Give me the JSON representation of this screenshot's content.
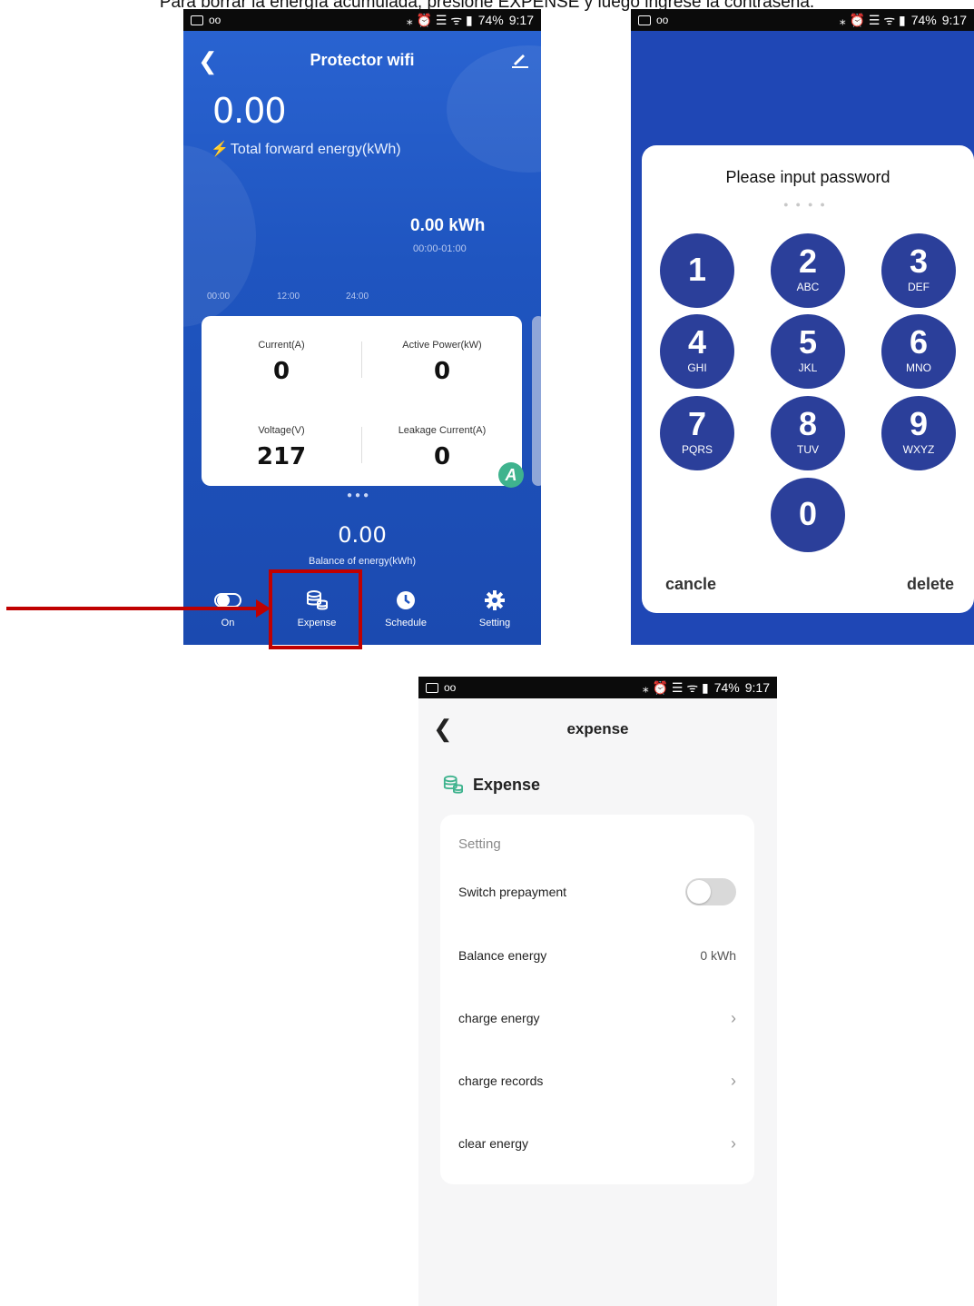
{
  "caption": "Para borrar la energía acumulada, presione EXPENSE y luego ingrese la contraseña.",
  "status": {
    "battery": "74%",
    "time": "9:17"
  },
  "colors": {
    "arrow": "#c00000",
    "app_blue": "#1f55c0",
    "key_blue": "#2b3f9a",
    "green_icon": "#3fb38e"
  },
  "home": {
    "title": "Protector wifi",
    "total_value": "0.00",
    "total_label": "Total forward energy(kWh)",
    "kwh_value": "0.00 kWh",
    "kwh_range": "00:00-01:00",
    "time_axis": [
      "00:00",
      "12:00",
      "24:00"
    ],
    "metrics": [
      {
        "label": "Current(A)",
        "value": "0"
      },
      {
        "label": "Active Power(kW)",
        "value": "0"
      },
      {
        "label": "Voltage(V)",
        "value": "217"
      },
      {
        "label": "Leakage Current(A)",
        "value": "0"
      }
    ],
    "badge": "A",
    "balance_value": "0.00",
    "balance_label": "Balance of energy(kWh)",
    "nav": [
      "On",
      "Expense",
      "Schedule",
      "Setting"
    ]
  },
  "password": {
    "title": "Please input password",
    "keys": [
      {
        "num": "1",
        "letters": ""
      },
      {
        "num": "2",
        "letters": "ABC"
      },
      {
        "num": "3",
        "letters": "DEF"
      },
      {
        "num": "4",
        "letters": "GHI"
      },
      {
        "num": "5",
        "letters": "JKL"
      },
      {
        "num": "6",
        "letters": "MNO"
      },
      {
        "num": "7",
        "letters": "PQRS"
      },
      {
        "num": "8",
        "letters": "TUV"
      },
      {
        "num": "9",
        "letters": "WXYZ"
      },
      {
        "num": "0",
        "letters": ""
      }
    ],
    "cancel": "cancle",
    "delete": "delete"
  },
  "expense": {
    "title": "expense",
    "header": "Expense",
    "section": "Setting",
    "switch_label": "Switch prepayment",
    "switch_on": false,
    "balance_label": "Balance energy",
    "balance_value": "0 kWh",
    "rows": [
      "charge energy",
      "charge records",
      "clear energy"
    ]
  }
}
